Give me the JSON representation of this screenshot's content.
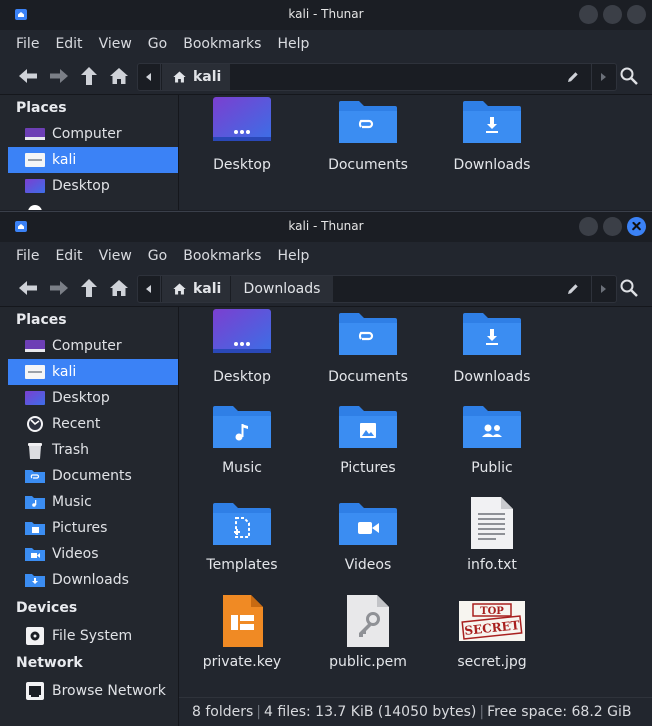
{
  "window": {
    "title": "kali - Thunar"
  },
  "menu": [
    "File",
    "Edit",
    "View",
    "Go",
    "Bookmarks",
    "Help"
  ],
  "path": {
    "home": "kali",
    "current": "Downloads"
  },
  "sidebar": {
    "places_heading": "Places",
    "places": [
      {
        "label": "Computer",
        "icon": "computer-icon"
      },
      {
        "label": "kali",
        "icon": "home-folder-icon",
        "selected": true
      },
      {
        "label": "Desktop",
        "icon": "desktop-icon"
      },
      {
        "label": "Recent",
        "icon": "recent-icon"
      },
      {
        "label": "Trash",
        "icon": "trash-icon"
      },
      {
        "label": "Documents",
        "icon": "documents-icon"
      },
      {
        "label": "Music",
        "icon": "music-icon"
      },
      {
        "label": "Pictures",
        "icon": "pictures-icon"
      },
      {
        "label": "Videos",
        "icon": "videos-icon"
      },
      {
        "label": "Downloads",
        "icon": "downloads-icon"
      }
    ],
    "devices_heading": "Devices",
    "devices": [
      {
        "label": "File System",
        "icon": "drive-icon"
      }
    ],
    "network_heading": "Network",
    "network": [
      {
        "label": "Browse Network",
        "icon": "network-icon"
      }
    ]
  },
  "files": [
    {
      "name": "Desktop",
      "icon": "desktop-folder-icon"
    },
    {
      "name": "Documents",
      "icon": "documents-folder-icon"
    },
    {
      "name": "Downloads",
      "icon": "downloads-folder-icon"
    },
    {
      "name": "Music",
      "icon": "music-folder-icon"
    },
    {
      "name": "Pictures",
      "icon": "pictures-folder-icon"
    },
    {
      "name": "Public",
      "icon": "public-folder-icon"
    },
    {
      "name": "Templates",
      "icon": "templates-folder-icon"
    },
    {
      "name": "Videos",
      "icon": "videos-folder-icon"
    },
    {
      "name": "info.txt",
      "icon": "text-file-icon"
    },
    {
      "name": "private.key",
      "icon": "key-file-icon"
    },
    {
      "name": "public.pem",
      "icon": "pem-file-icon"
    },
    {
      "name": "secret.jpg",
      "icon": "image-thumbnail-icon"
    }
  ],
  "thumbnail": {
    "line1": "TOP",
    "line2": "SECRET"
  },
  "status": {
    "folders": "8 folders",
    "files": "4 files: 13.7 KiB (14050 bytes)",
    "free": "Free space: 68.2 GiB"
  },
  "colors": {
    "accent": "#3b82f6",
    "folder": "#2f7fe6",
    "background": "#22262e"
  }
}
